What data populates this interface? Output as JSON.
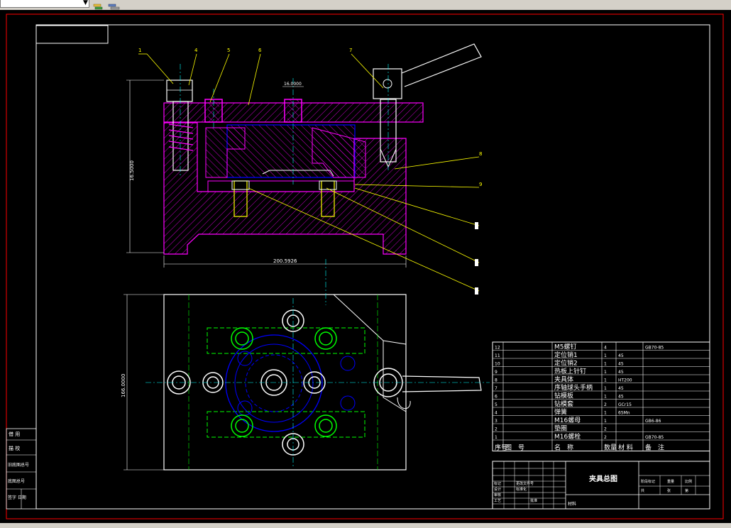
{
  "toolbar": {
    "layer_value": "",
    "icons": [
      "layer-properties-icon",
      "layer-states-icon"
    ]
  },
  "drawing": {
    "colors": {
      "border": "#ff0000",
      "frame": "#ffffff",
      "part": "#ff00ff",
      "hidden": "#0000ff",
      "center": "#00ff00",
      "dim": "#ffffff",
      "leader": "#ffff00",
      "bolt": "#ffff00",
      "cyan": "#00ffff"
    },
    "dims": {
      "height_front": "16.5000",
      "width_front": "200.5926",
      "height_top": "166.0000",
      "bush_fit": "16.0000"
    },
    "leaders": [
      "1",
      "4",
      "5",
      "6",
      "7",
      "8",
      "9"
    ],
    "parts": [
      {
        "no": "12",
        "name": "M5螺钉",
        "qty": "4",
        "mat": "",
        "note": "GB70-85"
      },
      {
        "no": "11",
        "name": "定位销1",
        "qty": "1",
        "mat": "45",
        "note": ""
      },
      {
        "no": "10",
        "name": "定位销2",
        "qty": "1",
        "mat": "45",
        "note": ""
      },
      {
        "no": "9",
        "name": "热板上针钉",
        "qty": "1",
        "mat": "45",
        "note": ""
      },
      {
        "no": "8",
        "name": "夹具体",
        "qty": "1",
        "mat": "HT200",
        "note": ""
      },
      {
        "no": "7",
        "name": "序轴球头手柄",
        "qty": "1",
        "mat": "45",
        "note": ""
      },
      {
        "no": "6",
        "name": "钻模板",
        "qty": "1",
        "mat": "45",
        "note": ""
      },
      {
        "no": "5",
        "name": "钻模套",
        "qty": "2",
        "mat": "GCr15",
        "note": ""
      },
      {
        "no": "4",
        "name": "弹簧",
        "qty": "1",
        "mat": "65Mn",
        "note": ""
      },
      {
        "no": "3",
        "name": "M16螺母",
        "qty": "1",
        "mat": "",
        "note": "GB6-86"
      },
      {
        "no": "2",
        "name": "垫圈",
        "qty": "2",
        "mat": "",
        "note": ""
      },
      {
        "no": "1",
        "name": "M16螺栓",
        "qty": "2",
        "mat": "",
        "note": "GB70-85"
      }
    ],
    "header": {
      "no": "序号",
      "code": "图　号",
      "name": "名　称",
      "qty": "数量",
      "mat": "材 料",
      "note": "备　注"
    },
    "title": "夹具总图",
    "side_labels": [
      "借 用",
      "描 校",
      "旧底图总号",
      "底图总号",
      "签字 日期"
    ],
    "tb_small": [
      "标记",
      "处数",
      "更改文件号",
      "签字",
      "日期",
      "设计",
      "标准化",
      "审核",
      "工艺",
      "批准"
    ],
    "material": "材料",
    "scale_labels": [
      "阶段标记",
      "重量",
      "比例",
      "共",
      "张",
      "第",
      "张"
    ]
  }
}
